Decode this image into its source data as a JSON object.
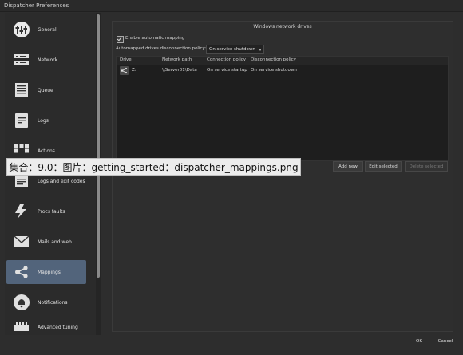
{
  "window": {
    "title": "Dispatcher Preferences"
  },
  "sidebar": {
    "items": [
      {
        "label": "General",
        "icon": "sliders-icon"
      },
      {
        "label": "Network",
        "icon": "network-icon"
      },
      {
        "label": "Queue",
        "icon": "queue-icon"
      },
      {
        "label": "Logs",
        "icon": "logs-icon"
      },
      {
        "label": "Actions",
        "icon": "actions-icon"
      },
      {
        "label": "Logs and exit codes",
        "icon": "exit-codes-icon"
      },
      {
        "label": "Procs faults",
        "icon": "lightning-icon"
      },
      {
        "label": "Mails and web",
        "icon": "mail-icon"
      },
      {
        "label": "Mappings",
        "icon": "share-icon",
        "active": true
      },
      {
        "label": "Notifications",
        "icon": "bell-icon"
      },
      {
        "label": "Advanced tuning",
        "icon": "tuning-icon"
      }
    ]
  },
  "panel": {
    "title": "Windows network drives",
    "enable_label": "Enable automatic mapping",
    "enable_checked": true,
    "policy_label": "Automapped drives disconnection policy:",
    "policy_value": "On service shutdown",
    "table": {
      "headers": [
        "Drive",
        "Network path",
        "Connection policy",
        "Disconnection policy"
      ],
      "rows": [
        {
          "drive": "Z:",
          "path": "\\\\Server01\\Data",
          "connection": "On service startup",
          "disconnection": "On service shutdown"
        }
      ]
    },
    "buttons": {
      "add": "Add new",
      "edit": "Edit selected",
      "delete": "Delete selected"
    }
  },
  "footer": {
    "ok": "OK",
    "cancel": "Cancel"
  },
  "watermark": {
    "text": "集合：9.0：图片：getting_started：dispatcher_mappings.png"
  }
}
